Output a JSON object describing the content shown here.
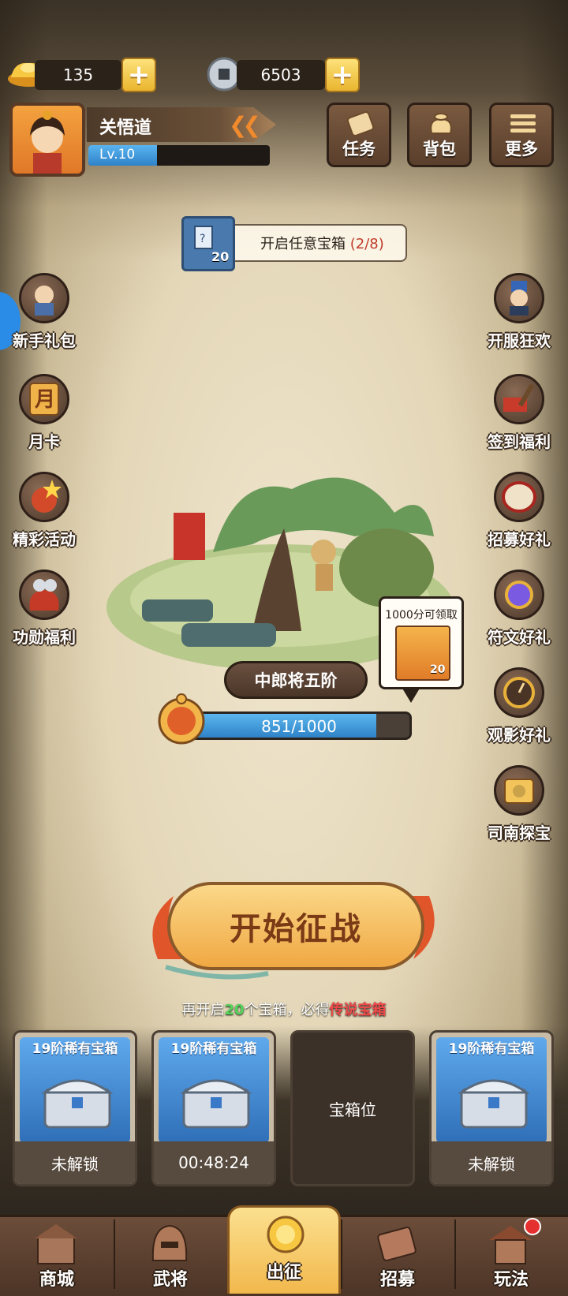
{
  "currency": {
    "gold": "135",
    "coins": "6503"
  },
  "player": {
    "name": "关悟道",
    "level": "Lv.10",
    "exp_fraction": 0.38
  },
  "top_buttons": [
    {
      "label": "任务",
      "icon": "scroll-icon"
    },
    {
      "label": "背包",
      "icon": "bag-icon"
    },
    {
      "label": "更多",
      "icon": "menu-icon"
    }
  ],
  "chest_task": {
    "count": "20",
    "text": "开启任意宝箱",
    "progress": "(2/8)"
  },
  "left_side": [
    {
      "label": "新手礼包"
    },
    {
      "label": "月卡",
      "glyph": "月"
    },
    {
      "label": "精彩活动"
    },
    {
      "label": "功勋福利"
    }
  ],
  "right_side": [
    {
      "label": "开服狂欢"
    },
    {
      "label": "签到福利"
    },
    {
      "label": "招募好礼"
    },
    {
      "label": "符文好礼"
    },
    {
      "label": "观影好礼"
    },
    {
      "label": "司南探宝"
    }
  ],
  "stage": {
    "rank": "中郎将五阶",
    "progress_text": "851/1000",
    "progress_fraction": 0.851,
    "reward_text": "1000分可领取",
    "reward_count": "20"
  },
  "battle_button": "开始征战",
  "hint": {
    "pre": "再开启",
    "num": "20",
    "mid": "个宝箱，必得",
    "highlight": "传说宝箱"
  },
  "slots": [
    {
      "title": "19阶稀有宝箱",
      "status": "未解锁"
    },
    {
      "title": "19阶稀有宝箱",
      "status": "00:48:24"
    },
    {
      "empty_label": "宝箱位"
    },
    {
      "title": "19阶稀有宝箱",
      "status": "未解锁"
    }
  ],
  "nav": [
    {
      "label": "商城"
    },
    {
      "label": "武将"
    },
    {
      "label": "出征"
    },
    {
      "label": "招募"
    },
    {
      "label": "玩法"
    }
  ],
  "colors": {
    "accent_gold": "#f2b84c",
    "progress_blue": "#2e83c7",
    "hint_green": "#55d45a",
    "hint_red": "#ef4a4a"
  }
}
